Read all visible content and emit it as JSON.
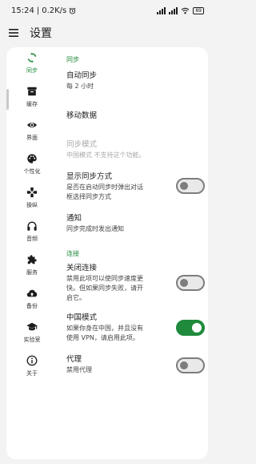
{
  "status_bar": {
    "time": "15:24",
    "speed": "0.2K/s",
    "alarm_icon": "alarm-icon",
    "signal1": "5G",
    "signal2": "5G",
    "battery": "89"
  },
  "app_bar": {
    "menu_icon": "menu-icon",
    "title": "设置"
  },
  "rail": {
    "items": [
      {
        "icon": "sync-icon",
        "label": "同步",
        "active": true
      },
      {
        "icon": "archive-icon",
        "label": "缓存",
        "active": false
      },
      {
        "icon": "eye-icon",
        "label": "界面",
        "active": false
      },
      {
        "icon": "palette-icon",
        "label": "个性化",
        "active": false
      },
      {
        "icon": "gamepad-icon",
        "label": "操纵",
        "active": false
      },
      {
        "icon": "headphones-icon",
        "label": "音频",
        "active": false
      },
      {
        "icon": "puzzle-icon",
        "label": "服务",
        "active": false
      },
      {
        "icon": "cloud-upload-icon",
        "label": "备份",
        "active": false
      },
      {
        "icon": "school-icon",
        "label": "实验室",
        "active": false
      },
      {
        "icon": "info-icon",
        "label": "关于",
        "active": false
      }
    ]
  },
  "settings": {
    "section_sync": "同步",
    "auto_sync": {
      "title": "自动同步",
      "summary": "每 2 小时"
    },
    "mobile_data": {
      "title": "移动数据"
    },
    "sync_mode": {
      "title": "同步模式",
      "summary": "中国模式 不支持这个功能。"
    },
    "show_sync_method": {
      "title": "显示同步方式",
      "summary_line1": "是否在启动同步时弹出对话",
      "summary_line2": "框选择同步方式",
      "enabled": false
    },
    "notification": {
      "title": "通知",
      "summary": "同步完成时发出通知"
    },
    "section_connection": "连接",
    "close_connection": {
      "title": "关闭连接",
      "summary_line1": "禁用此项可以使同步速度更",
      "summary_line2": "快。但如果同步失败，请开",
      "summary_line3": "启它。",
      "enabled": false
    },
    "china_mode": {
      "title": "中国模式",
      "summary_line1": "如果你身在中国，并且没有",
      "summary_line2": "使用 VPN，请启用此项。",
      "enabled": true
    },
    "proxy": {
      "title": "代理",
      "summary": "禁用代理",
      "enabled": false
    }
  },
  "colors": {
    "accent": "#1f8a3b",
    "background": "#f3f3f3",
    "card": "#ffffff"
  }
}
